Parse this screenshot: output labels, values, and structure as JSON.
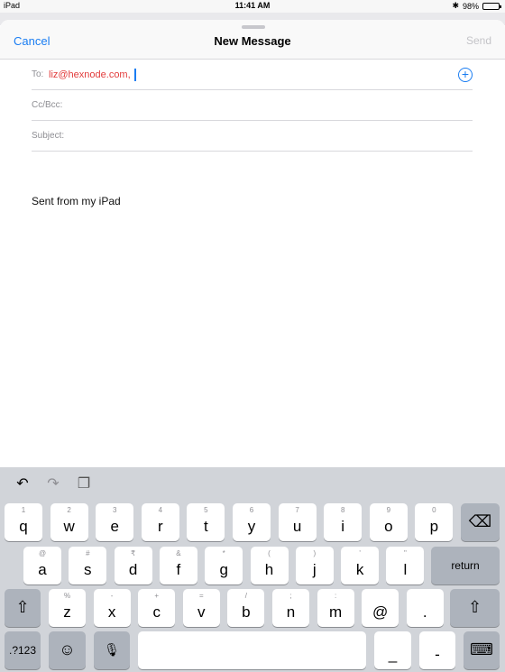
{
  "status_bar": {
    "device": "iPad",
    "time": "11:41 AM",
    "battery": "98%",
    "battery_level": 0.98,
    "bluetooth": "✱"
  },
  "compose": {
    "cancel": "Cancel",
    "title": "New Message",
    "send": "Send",
    "to_label": "To:",
    "to_value": "liz@hexnode.com,",
    "cc_label": "Cc/Bcc:",
    "subject_label": "Subject:",
    "body": "Sent from my iPad"
  },
  "keyboard": {
    "row1": [
      {
        "sec": "1",
        "main": "q"
      },
      {
        "sec": "2",
        "main": "w"
      },
      {
        "sec": "3",
        "main": "e"
      },
      {
        "sec": "4",
        "main": "r"
      },
      {
        "sec": "5",
        "main": "t"
      },
      {
        "sec": "6",
        "main": "y"
      },
      {
        "sec": "7",
        "main": "u"
      },
      {
        "sec": "8",
        "main": "i"
      },
      {
        "sec": "9",
        "main": "o"
      },
      {
        "sec": "0",
        "main": "p"
      }
    ],
    "row2": [
      {
        "sec": "@",
        "main": "a"
      },
      {
        "sec": "#",
        "main": "s"
      },
      {
        "sec": "₹",
        "main": "d"
      },
      {
        "sec": "&",
        "main": "f"
      },
      {
        "sec": "*",
        "main": "g"
      },
      {
        "sec": "(",
        "main": "h"
      },
      {
        "sec": ")",
        "main": "j"
      },
      {
        "sec": "'",
        "main": "k"
      },
      {
        "sec": "\"",
        "main": "l"
      }
    ],
    "row3": [
      {
        "sec": "%",
        "main": "z"
      },
      {
        "sec": "-",
        "main": "x"
      },
      {
        "sec": "+",
        "main": "c"
      },
      {
        "sec": "=",
        "main": "v"
      },
      {
        "sec": "/",
        "main": "b"
      },
      {
        "sec": ";",
        "main": "n"
      },
      {
        "sec": ":",
        "main": "m"
      },
      {
        "sec": "",
        "main": "@"
      },
      {
        "sec": "",
        "main": "."
      }
    ],
    "return_label": "return",
    "numbers_label": ".?123",
    "underscore": "_",
    "dash": "-",
    "icons": {
      "undo": "↶",
      "redo": "↷",
      "paste": "❐",
      "delete": "⌫",
      "shift": "⇧",
      "emoji": "☺",
      "mic": "🎙",
      "dismiss": "⌨"
    }
  }
}
